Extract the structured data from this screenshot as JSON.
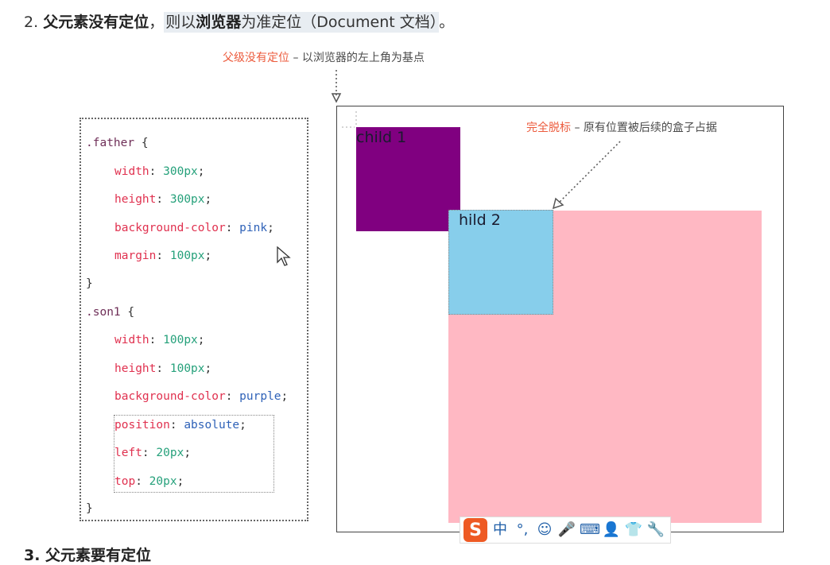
{
  "heading": {
    "num": "2.",
    "bold1": "父元素没有定位",
    "comma": "，",
    "mid1": "则以",
    "bold2": "浏览器",
    "mid2": "为准定位（Document 文档）",
    "end": "。"
  },
  "annotations": {
    "top_red": "父级没有定位",
    "top_gray": " – 以浏览器的左上角为基点",
    "side_red": "完全脱标",
    "side_gray": " – 原有位置被后续的盒子占据"
  },
  "code": {
    "father_selector": ".father",
    "open": " {",
    "close": "}",
    "son1_selector": ".son1",
    "father_props": [
      {
        "prop": "width",
        "val": "300px"
      },
      {
        "prop": "height",
        "val": "300px"
      },
      {
        "prop": "background-color",
        "val": "pink"
      },
      {
        "prop": "margin",
        "val": "100px"
      }
    ],
    "son1_props": [
      {
        "prop": "width",
        "val": "100px"
      },
      {
        "prop": "height",
        "val": "100px"
      },
      {
        "prop": "background-color",
        "val": "purple"
      },
      {
        "prop": "position",
        "val": "absolute"
      },
      {
        "prop": "left",
        "val": "20px"
      },
      {
        "prop": "top",
        "val": "20px"
      }
    ]
  },
  "demo": {
    "child1_label": "child 1",
    "child2_label": "hild 2",
    "colors": {
      "pink": "#ffb8c3",
      "purple": "#800080",
      "skyblue": "#87ceeb"
    }
  },
  "toolbar": {
    "logo": "S",
    "items": [
      "中",
      "°,",
      "☺",
      "🎤",
      "⌨",
      "👤",
      "👕",
      "🔧"
    ],
    "icons": [
      "sogou-logo-icon",
      "chinese-mode-icon",
      "punctuation-icon",
      "emoji-icon",
      "microphone-icon",
      "keyboard-icon",
      "user-icon",
      "skin-icon",
      "settings-wrench-icon"
    ]
  },
  "next_heading": "3. 父元素要有定位"
}
